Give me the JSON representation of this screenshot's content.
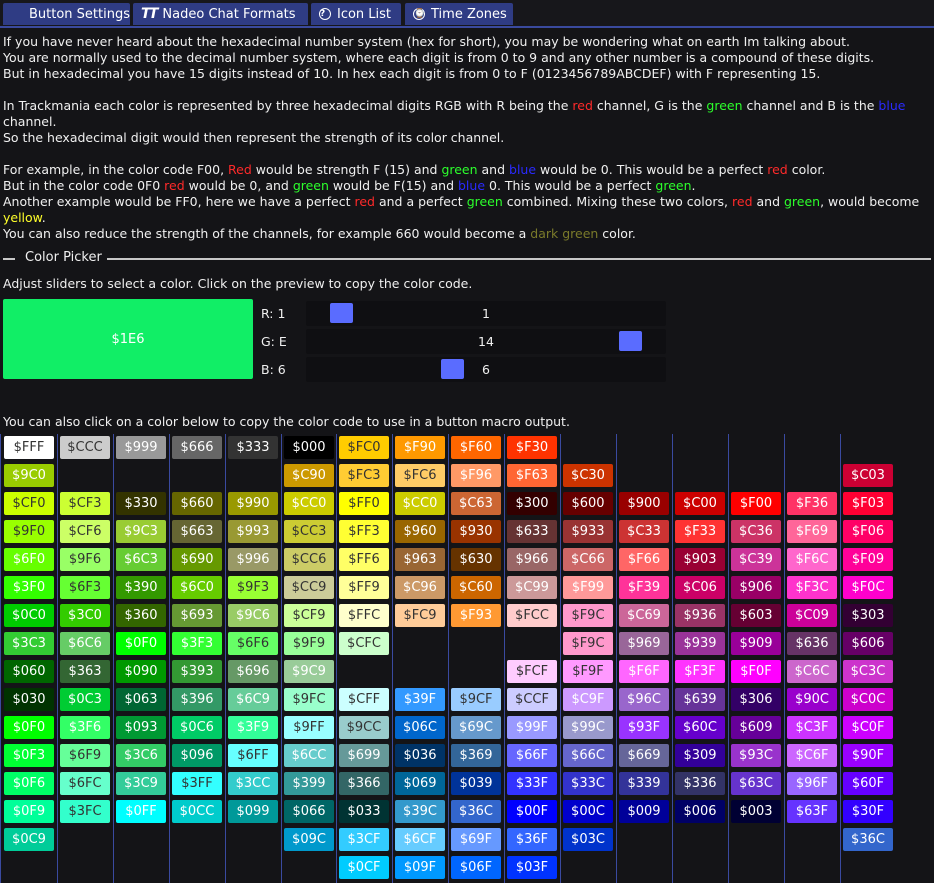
{
  "tabs": [
    {
      "label": "Button Settings",
      "icon": "grid-icon"
    },
    {
      "label": "Nadeo Chat Formats",
      "icon": "trackmania-logo-icon"
    },
    {
      "label": "Icon List",
      "icon": "question-circle-icon"
    },
    {
      "label": "Time Zones",
      "icon": "clock-icon"
    }
  ],
  "intro": {
    "p1": "If you have never heard about the hexadecimal number system (hex for short), you may be wondering what on earth Im talking about.",
    "p2": "You are normally used to the decimal number system, where each digit is from 0 to 9 and any other number is a compound of these digits.",
    "p3": "But in hexadecimal you have 15 digits instead of 10. In hex each digit is from 0 to F (0123456789ABCDEF) with F representing 15.",
    "p4a": "In Trackmania each color is represented by three hexadecimal digits RGB with R being the ",
    "red": "red",
    "p4b": " channel, G is the ",
    "green": "green",
    "p4c": " channel and B is the ",
    "blue": "blue",
    "p4d": " channel.",
    "p5": "So the hexadecimal digit would then represent the strength of its color channel.",
    "p6a": "For example, in the color code F00, ",
    "p6red": "Red",
    "p6b": " would be strength F (15) and ",
    "p6c": " and ",
    "p6d": " would be 0. This would be a perfect ",
    "p6e": " color.",
    "p7a": "But in the color code 0F0 ",
    "p7b": " would be 0, and ",
    "p7c": " would be F(15) and ",
    "p7d": " 0. This would be a perfect ",
    "p7e": ".",
    "p8a": "Another example would be FF0, here we have a perfect ",
    "p8b": " and a perfect ",
    "p8c": " combined. Mixing these two colors, ",
    "p8d": " and ",
    "p8e": ", would become ",
    "yellow": "yellow",
    "p8f": ".",
    "p9a": "You can also reduce the strength of the channels, for example 660 would become a ",
    "darkgreen": "dark green",
    "p9b": " color."
  },
  "picker": {
    "section_title": "Color Picker",
    "instructions": "Adjust sliders to select a color. Click on the preview to copy the color code.",
    "preview_code": "$1E6",
    "preview_color": "#11ee66",
    "r_label": "R: 1",
    "r_value": "1",
    "g_label": "G: E",
    "g_value": "14",
    "b_label": "B: 6",
    "b_value": "6",
    "palette_instructions": "You can also click on a color below to copy the color code to use in a button macro output."
  },
  "palette": [
    [
      "FFF",
      "CCC",
      "999",
      "666",
      "333",
      "000",
      "FC0",
      "F90",
      "F60",
      "F30",
      "",
      "",
      "",
      "",
      "",
      ""
    ],
    [
      "9C0",
      "",
      "",
      "",
      "",
      "C90",
      "FC3",
      "FC6",
      "F96",
      "F63",
      "C30",
      "",
      "",
      "",
      "",
      "C03"
    ],
    [
      "CF0",
      "CF3",
      "330",
      "660",
      "990",
      "CC0",
      "FF0",
      "CC0",
      "C63",
      "300",
      "600",
      "900",
      "C00",
      "F00",
      "F36",
      "F03"
    ],
    [
      "9F0",
      "CF6",
      "9C3",
      "663",
      "993",
      "CC3",
      "FF3",
      "960",
      "930",
      "633",
      "933",
      "C33",
      "F33",
      "C36",
      "F69",
      "F06"
    ],
    [
      "6F0",
      "9F6",
      "6C3",
      "690",
      "996",
      "CC6",
      "FF6",
      "963",
      "630",
      "966",
      "C66",
      "F66",
      "903",
      "C39",
      "F6C",
      "F09"
    ],
    [
      "3F0",
      "6F3",
      "390",
      "6C0",
      "9F3",
      "CC9",
      "FF9",
      "C96",
      "C60",
      "C99",
      "F99",
      "F39",
      "C06",
      "906",
      "F3C",
      "F0C"
    ],
    [
      "0C0",
      "3C0",
      "360",
      "693",
      "9C6",
      "CF9",
      "FFC",
      "FC9",
      "F93",
      "FCC",
      "F9C",
      "C69",
      "936",
      "603",
      "C09",
      "303"
    ],
    [
      "3C3",
      "6C6",
      "0F0",
      "3F3",
      "6F6",
      "9F9",
      "CFC",
      "",
      "",
      "",
      "F9C",
      "969",
      "939",
      "909",
      "636",
      "606"
    ],
    [
      "060",
      "363",
      "090",
      "393",
      "696",
      "9C9",
      "",
      "",
      "",
      "FCF",
      "F9F",
      "F6F",
      "F3F",
      "F0F",
      "C6C",
      "C3C"
    ],
    [
      "030",
      "0C3",
      "063",
      "396",
      "6C9",
      "9FC",
      "CFF",
      "39F",
      "9CF",
      "CCF",
      "C9F",
      "96C",
      "639",
      "306",
      "90C",
      "C0C"
    ],
    [
      "0F0",
      "3F6",
      "093",
      "0C6",
      "3F9",
      "9FF",
      "9CC",
      "06C",
      "69C",
      "99F",
      "99C",
      "93F",
      "60C",
      "609",
      "C3F",
      "C0F"
    ],
    [
      "0F3",
      "6F9",
      "3C6",
      "096",
      "6FF",
      "6CC",
      "699",
      "036",
      "369",
      "66F",
      "66C",
      "669",
      "309",
      "93C",
      "C6F",
      "90F"
    ],
    [
      "0F6",
      "6FC",
      "3C9",
      "3FF",
      "3CC",
      "399",
      "366",
      "069",
      "039",
      "33F",
      "33C",
      "339",
      "336",
      "63C",
      "96F",
      "60F"
    ],
    [
      "0F9",
      "3FC",
      "0FF",
      "0CC",
      "099",
      "066",
      "033",
      "39C",
      "36C",
      "00F",
      "00C",
      "009",
      "006",
      "003",
      "63F",
      "30F"
    ],
    [
      "0C9",
      "",
      "",
      "",
      "",
      "09C",
      "3CF",
      "6CF",
      "69F",
      "36F",
      "03C",
      "",
      "",
      "",
      "",
      "36C"
    ],
    [
      "",
      "",
      "",
      "",
      "",
      "",
      "0CF",
      "09F",
      "06F",
      "03F",
      "",
      "",
      "",
      "",
      "",
      ""
    ]
  ]
}
